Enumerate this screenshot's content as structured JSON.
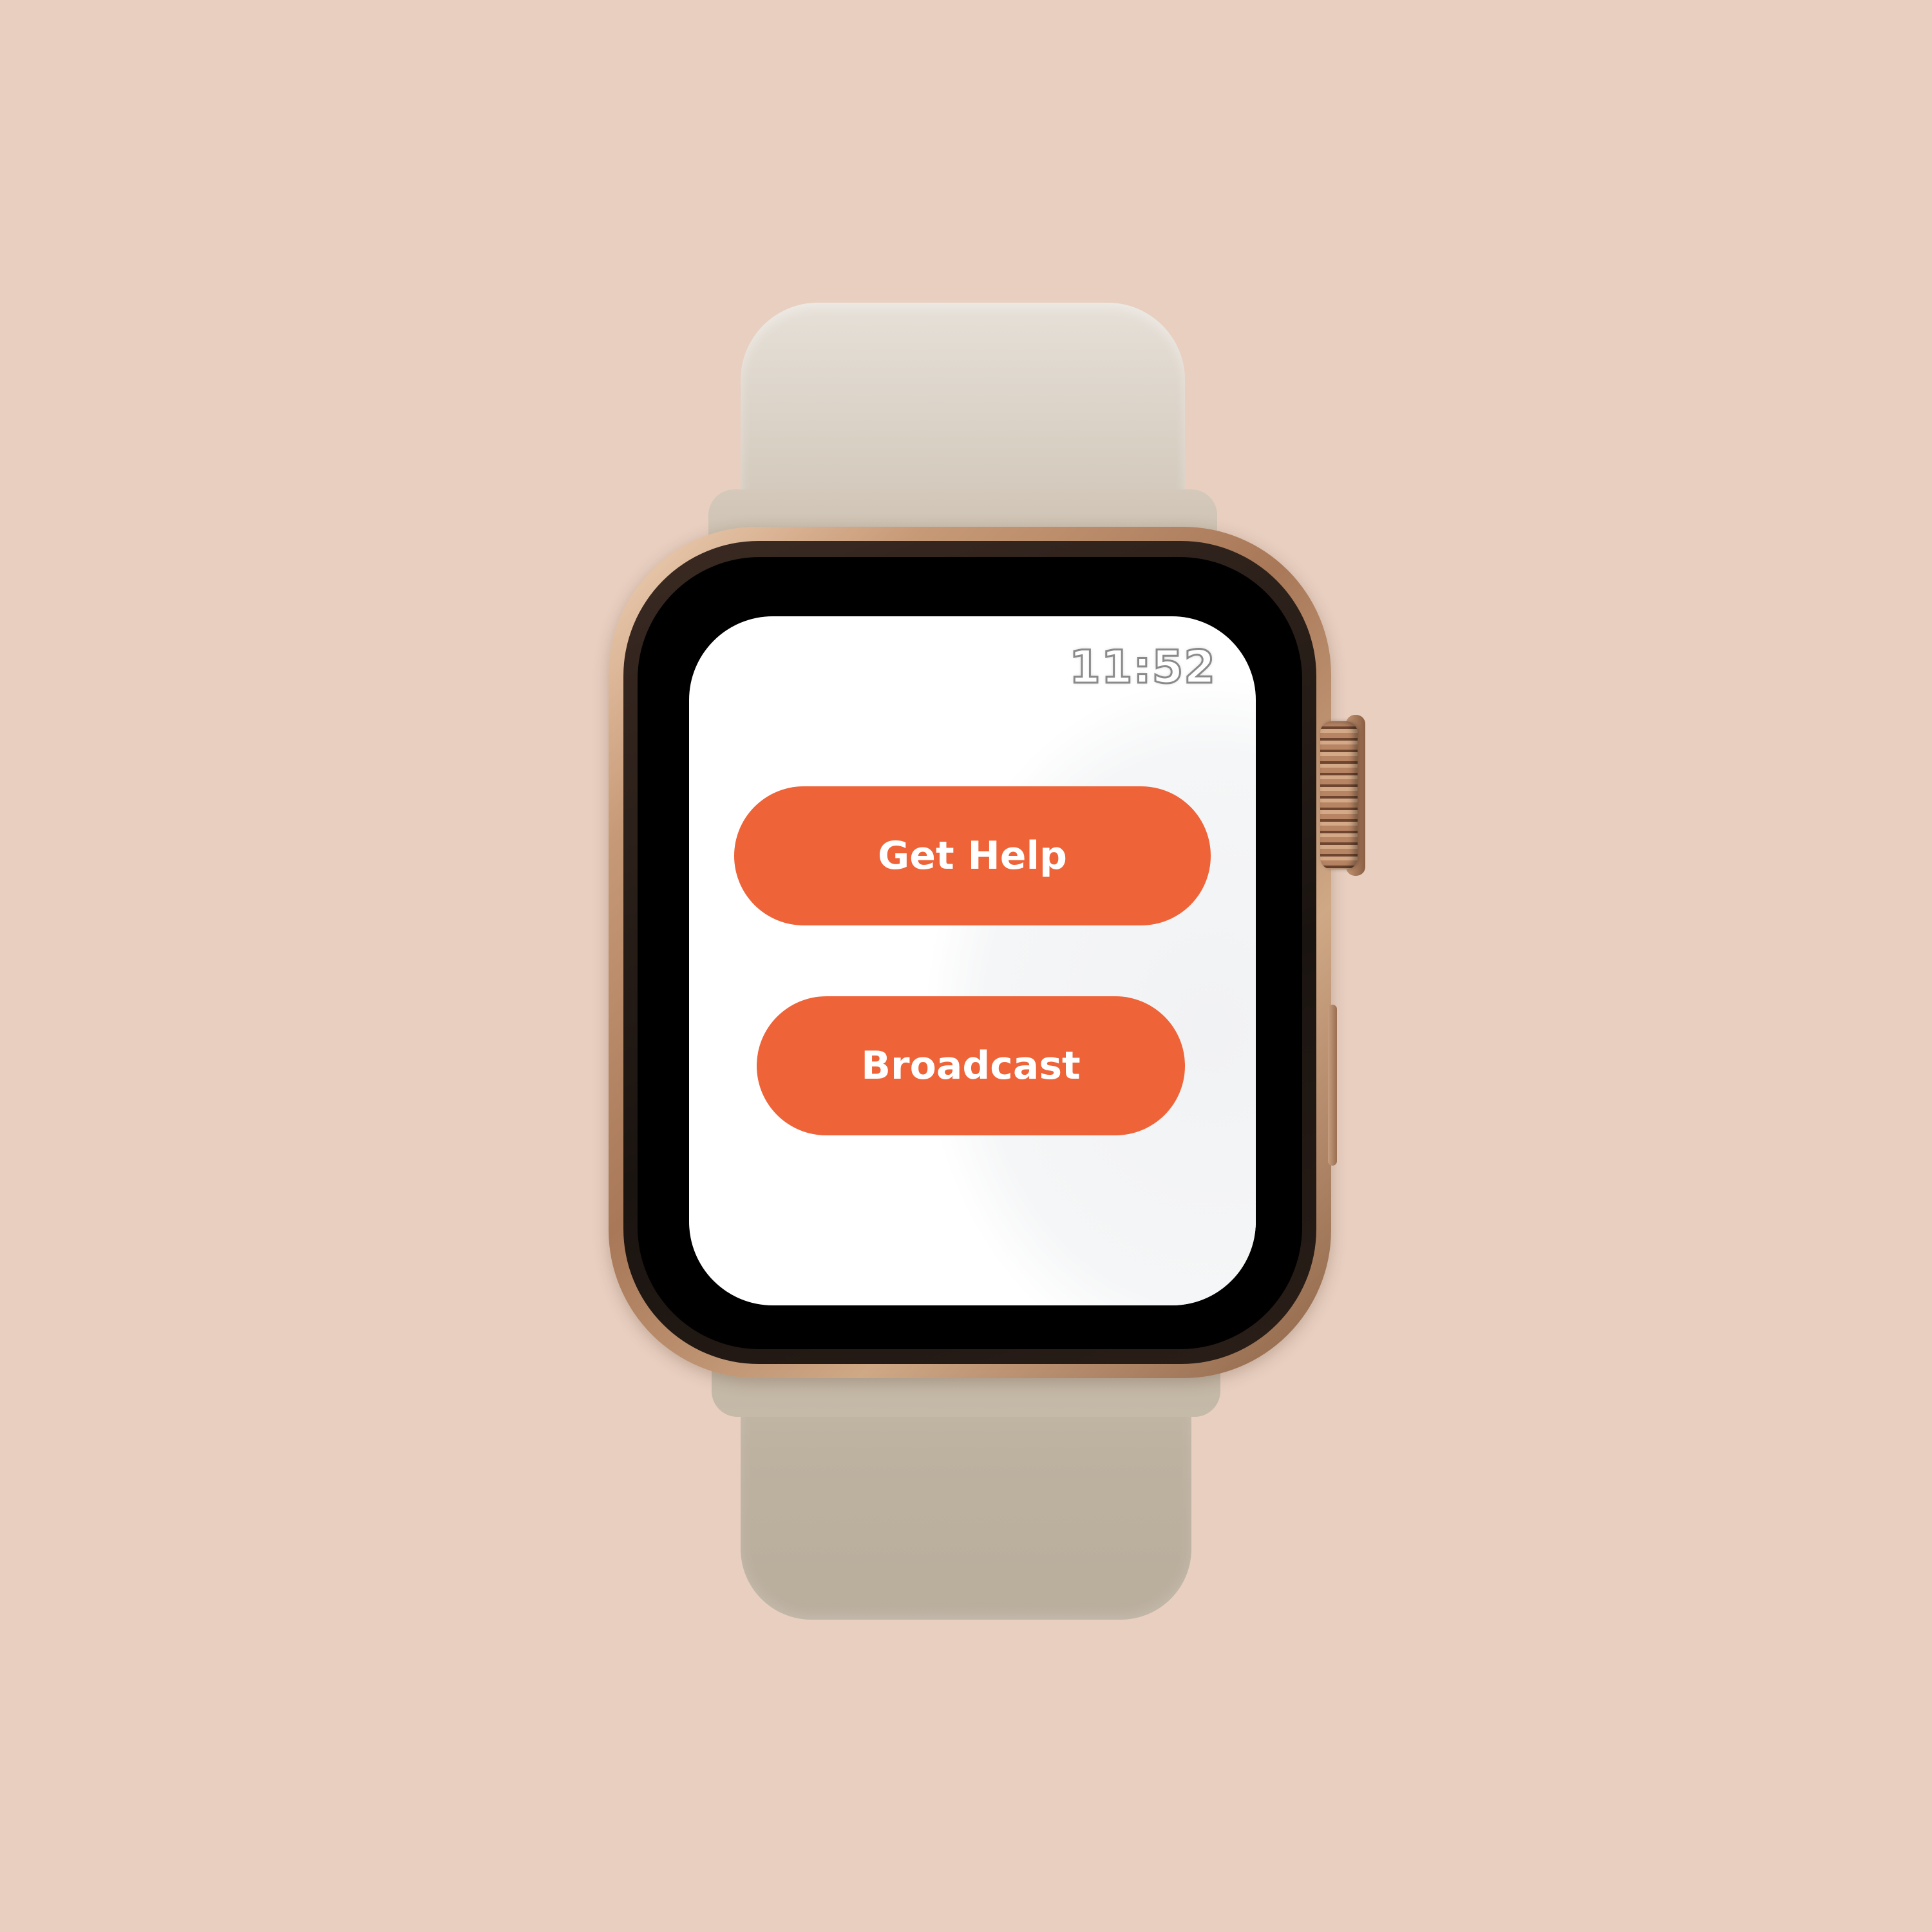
{
  "status_bar": {
    "time": "11:52"
  },
  "buttons": {
    "get_help_label": "Get Help",
    "broadcast_label": "Broadcast"
  },
  "colors": {
    "background": "#e8cfc0",
    "button": "#ee6338",
    "button_text": "#ffffff",
    "screen": "#ffffff",
    "band": "#d6ccc0",
    "case": "#b88564"
  },
  "device": {
    "type": "smartwatch"
  }
}
